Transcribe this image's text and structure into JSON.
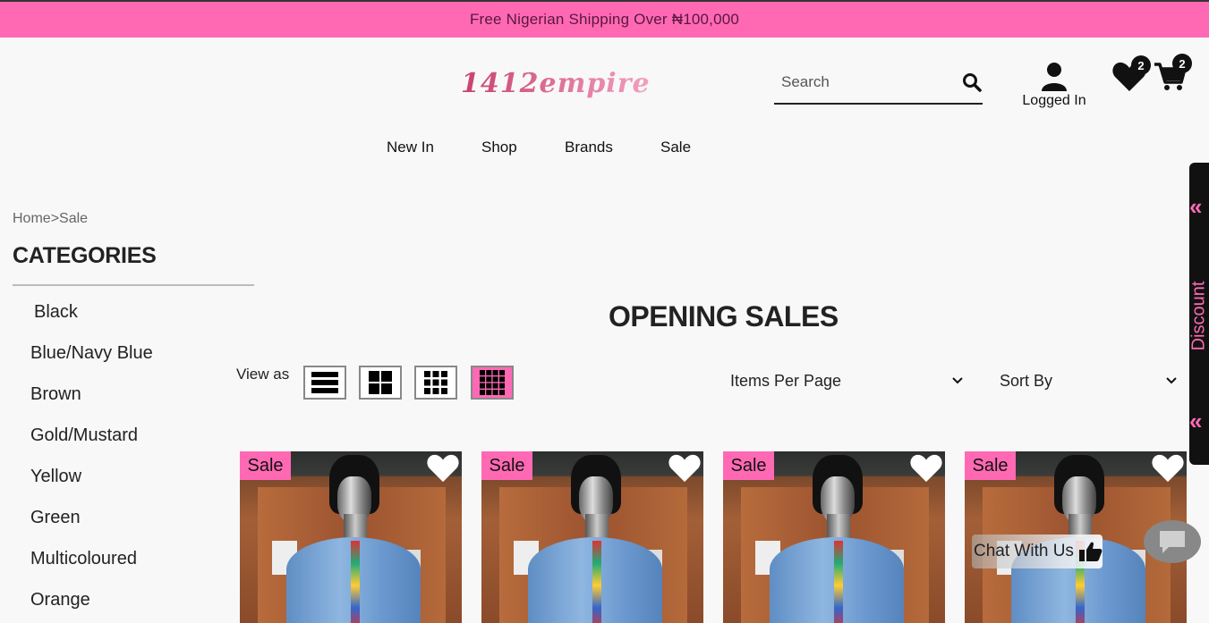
{
  "announcement": "Free Nigerian Shipping Over ₦100,000",
  "brand": {
    "logo_text": "1412empire",
    "accent": "#ff69b4"
  },
  "header": {
    "search_placeholder": "Search",
    "account_label": "Logged In",
    "wishlist_count": "2",
    "cart_count": "2"
  },
  "nav": [
    "New In",
    "Shop",
    "Brands",
    "Sale"
  ],
  "breadcrumb": {
    "home": "Home",
    "separator": ">",
    "current": "Sale"
  },
  "sidebar": {
    "title": "CATEGORIES",
    "items": [
      "Black",
      "Blue/Navy Blue",
      "Brown",
      "Gold/Mustard",
      "Yellow",
      "Green",
      "Multicoloured",
      "Orange"
    ]
  },
  "main": {
    "title": "OPENING SALES",
    "view_as_label": "View as",
    "view_modes": [
      "list",
      "grid-2",
      "grid-3",
      "grid-4"
    ],
    "active_view": "grid-4",
    "items_per_page_label": "Items Per Page",
    "sort_by_label": "Sort By"
  },
  "products": [
    {
      "badge": "Sale"
    },
    {
      "badge": "Sale"
    },
    {
      "badge": "Sale"
    },
    {
      "badge": "Sale"
    }
  ],
  "discount_tab": {
    "label": "Discount"
  },
  "chat": {
    "label": "Chat With Us"
  }
}
